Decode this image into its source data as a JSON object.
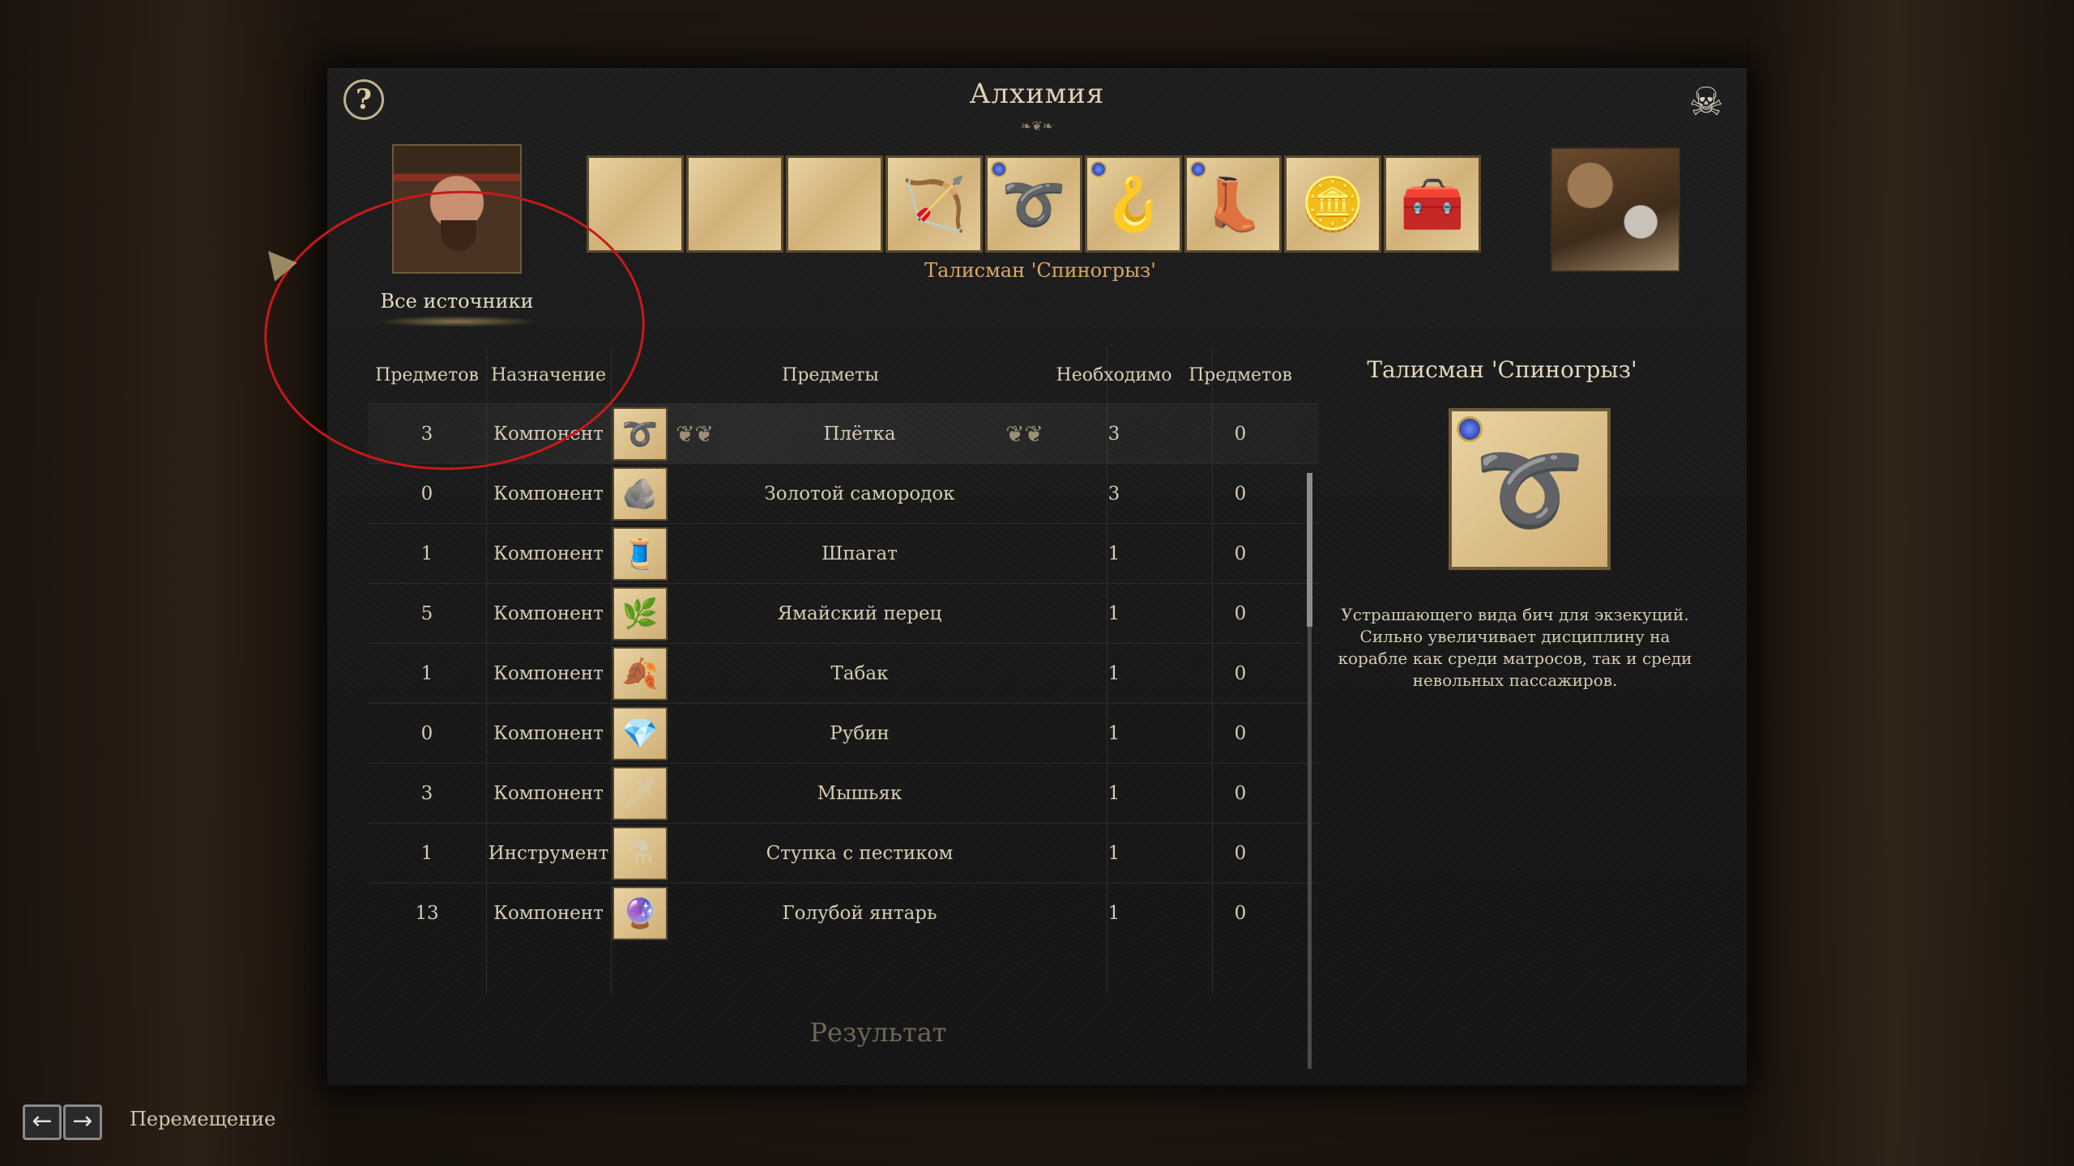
{
  "window": {
    "title": "Алхимия",
    "help": "?",
    "close": "☠"
  },
  "portrait": {
    "sources_label": "Все источники"
  },
  "slots": [
    {
      "icon": "",
      "gem": false
    },
    {
      "icon": "",
      "gem": false
    },
    {
      "icon": "",
      "gem": false
    },
    {
      "icon": "🏹",
      "gem": false
    },
    {
      "icon": "➰",
      "gem": true
    },
    {
      "icon": "🪝",
      "gem": true
    },
    {
      "icon": "👢",
      "gem": true
    },
    {
      "icon": "🪙",
      "gem": false
    },
    {
      "icon": "🧰",
      "gem": false
    }
  ],
  "selected_slot_name": "Талисман 'Спиногрыз'",
  "table": {
    "headers": {
      "count": "Предметов",
      "type": "Назначение",
      "name": "Предметы",
      "need": "Необходимо",
      "have": "Предметов"
    },
    "rows": [
      {
        "count": "3",
        "type": "Компонент",
        "icon": "➰",
        "name": "Плётка",
        "need": "3",
        "have": "0",
        "selected": true
      },
      {
        "count": "0",
        "type": "Компонент",
        "icon": "🪨",
        "name": "Золотой самородок",
        "need": "3",
        "have": "0"
      },
      {
        "count": "1",
        "type": "Компонент",
        "icon": "🧵",
        "name": "Шпагат",
        "need": "1",
        "have": "0"
      },
      {
        "count": "5",
        "type": "Компонент",
        "icon": "🌿",
        "name": "Ямайский перец",
        "need": "1",
        "have": "0"
      },
      {
        "count": "1",
        "type": "Компонент",
        "icon": "🍂",
        "name": "Табак",
        "need": "1",
        "have": "0"
      },
      {
        "count": "0",
        "type": "Компонент",
        "icon": "💎",
        "name": "Рубин",
        "need": "1",
        "have": "0"
      },
      {
        "count": "3",
        "type": "Компонент",
        "icon": "🗡",
        "name": "Мышьяк",
        "need": "1",
        "have": "0"
      },
      {
        "count": "1",
        "type": "Инструмент",
        "icon": "⚗",
        "name": "Ступка с пестиком",
        "need": "1",
        "have": "0"
      },
      {
        "count": "13",
        "type": "Компонент",
        "icon": "🔮",
        "name": "Голубой янтарь",
        "need": "1",
        "have": "0"
      }
    ],
    "ornament_left": "❦❦",
    "ornament_right": "❦❦"
  },
  "result_label": "Результат",
  "details": {
    "title": "Талисман 'Спиногрыз'",
    "icon": "➰",
    "description": "Устрашающего вида бич для экзекуций. Сильно увеличивает дисциплину на корабле как среди матросов, так и среди невольных пассажиров."
  },
  "footer": {
    "key_left": "←",
    "key_right": "→",
    "hint": "Перемещение"
  },
  "colors": {
    "highlight": "#c81919",
    "selected_name": "#d9a86a"
  }
}
